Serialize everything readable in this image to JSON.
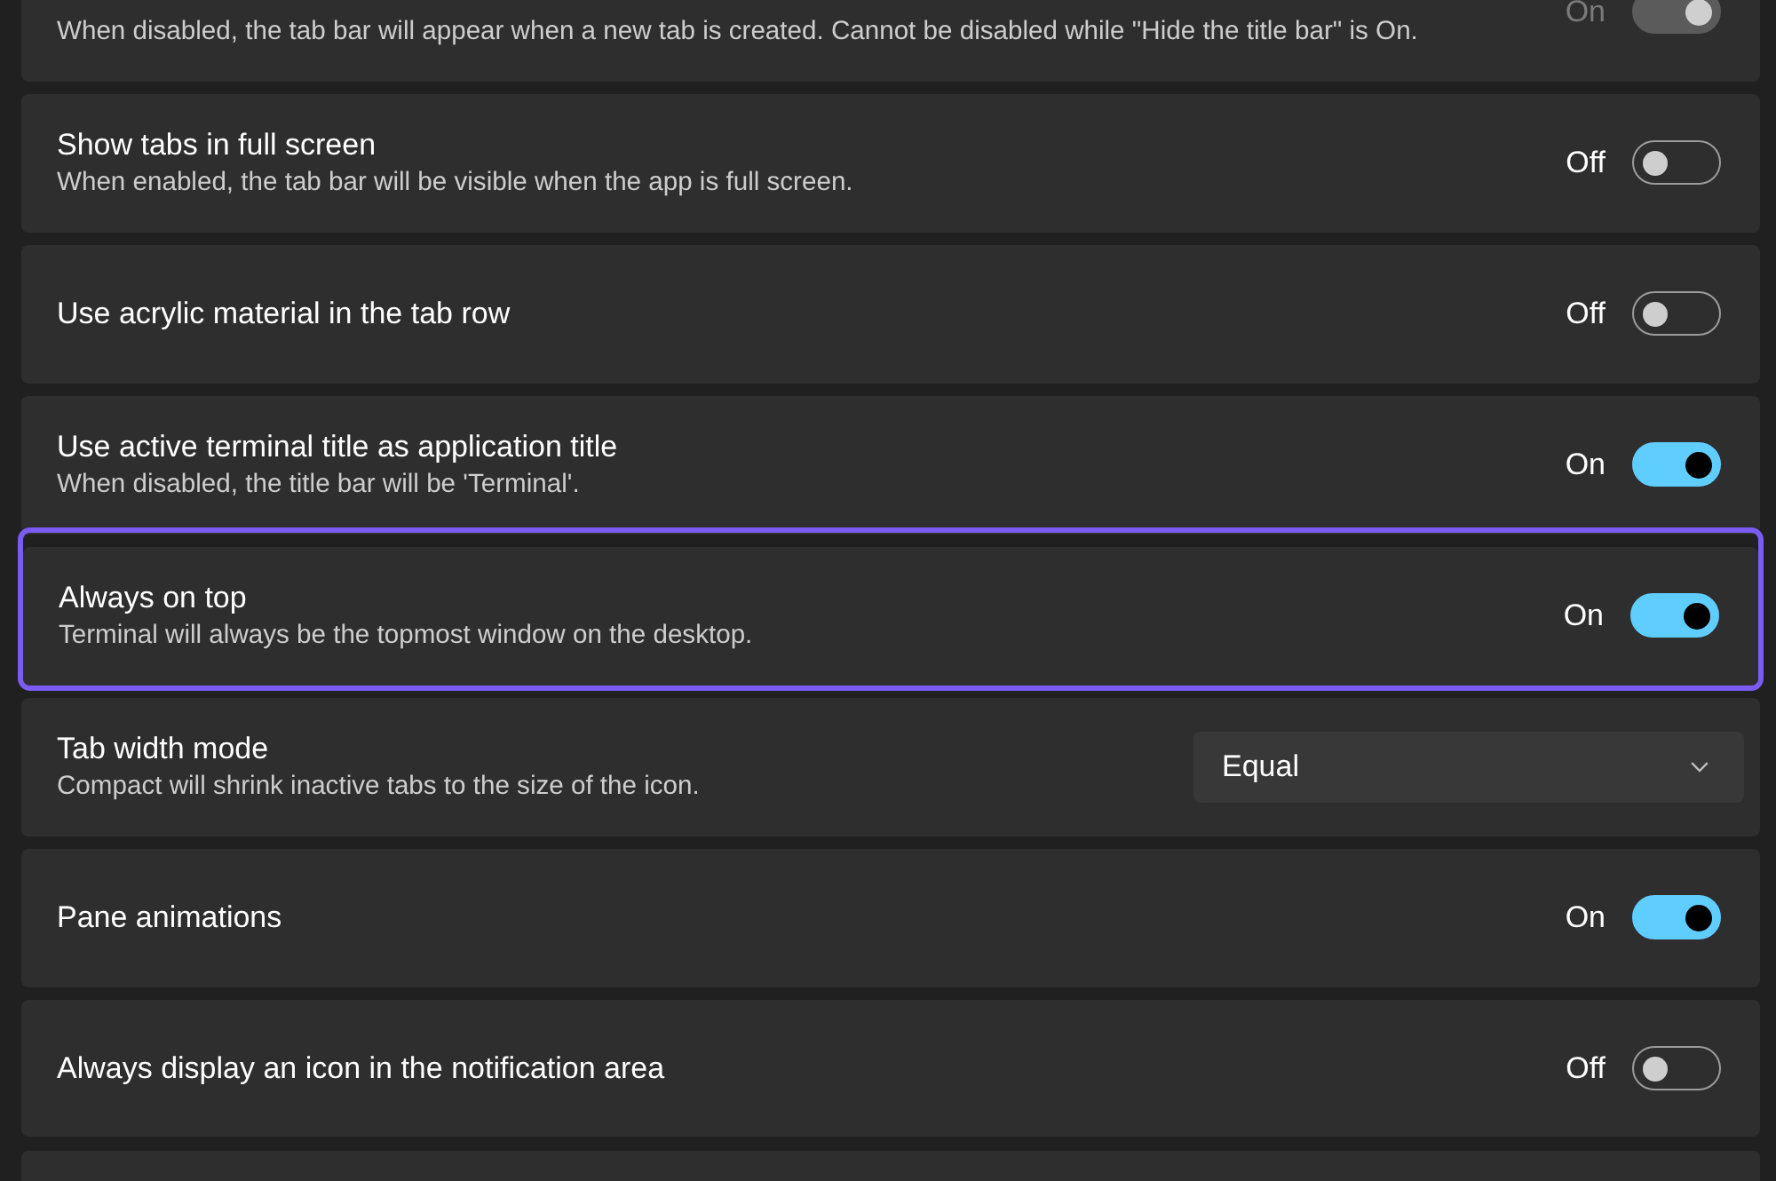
{
  "settings": [
    {
      "kind": "toggle",
      "description": "When disabled, the tab bar will appear when a new tab is created. Cannot be disabled while \"Hide the title bar\" is On.",
      "state_label": "On",
      "on": true,
      "disabled": true,
      "focused": false
    },
    {
      "kind": "toggle",
      "title": "Show tabs in full screen",
      "description": "When enabled, the tab bar will be visible when the app is full screen.",
      "state_label": "Off",
      "on": false,
      "disabled": false,
      "focused": false
    },
    {
      "kind": "toggle",
      "title": "Use acrylic material in the tab row",
      "state_label": "Off",
      "on": false,
      "disabled": false,
      "focused": false
    },
    {
      "kind": "toggle",
      "title": "Use active terminal title as application title",
      "description": "When disabled, the title bar will be 'Terminal'.",
      "state_label": "On",
      "on": true,
      "disabled": false,
      "focused": false
    },
    {
      "kind": "toggle",
      "title": "Always on top",
      "description": "Terminal will always be the topmost window on the desktop.",
      "state_label": "On",
      "on": true,
      "disabled": false,
      "focused": true
    },
    {
      "kind": "dropdown",
      "title": "Tab width mode",
      "description": "Compact will shrink inactive tabs to the size of the icon.",
      "value": "Equal",
      "focused": false
    },
    {
      "kind": "toggle",
      "title": "Pane animations",
      "state_label": "On",
      "on": true,
      "disabled": false,
      "focused": false
    },
    {
      "kind": "toggle",
      "title": "Always display an icon in the notification area",
      "state_label": "Off",
      "on": false,
      "disabled": false,
      "focused": false
    },
    {
      "kind": "blank"
    }
  ]
}
